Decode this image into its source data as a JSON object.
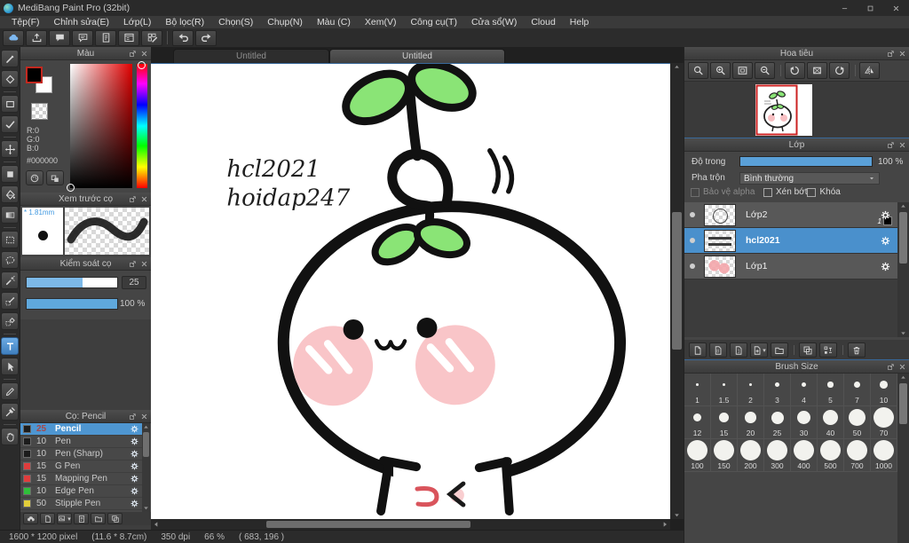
{
  "window": {
    "title": "MediBang Paint Pro (32bit)"
  },
  "menu": {
    "items": [
      "Tệp(F)",
      "Chỉnh sửa(E)",
      "Lớp(L)",
      "Bộ lọc(R)",
      "Chọn(S)",
      "Chụp(N)",
      "Màu (C)",
      "Xem(V)",
      "Công cụ(T)",
      "Cửa sổ(W)",
      "Cloud",
      "Help"
    ]
  },
  "toolbar": {
    "buttons": [
      {
        "icon": "cloud",
        "name": "cloud-save-button",
        "color": "#7db7ef"
      },
      {
        "icon": "upload",
        "name": "upload-button"
      },
      {
        "icon": "chat",
        "name": "comment-button"
      },
      {
        "icon": "chat2",
        "name": "feedback-button"
      },
      {
        "icon": "doc",
        "name": "document-button"
      },
      {
        "icon": "winlist",
        "name": "panel-layout-button"
      },
      {
        "icon": "gridpen",
        "name": "material-button"
      }
    ],
    "history": [
      {
        "icon": "undo",
        "name": "undo-button"
      },
      {
        "icon": "redo",
        "name": "redo-button"
      }
    ]
  },
  "tools": {
    "items": [
      {
        "icon": "pen",
        "name": "pen-tool"
      },
      {
        "icon": "eraser",
        "name": "eraser-tool"
      },
      {
        "icon": "rect",
        "name": "shape-tool",
        "gap": true
      },
      {
        "icon": "check",
        "name": "snap-tool"
      },
      {
        "icon": "move",
        "name": "move-tool",
        "gap": true
      },
      {
        "icon": "fillrect",
        "name": "fill-shape-tool",
        "gap": true
      },
      {
        "icon": "bucket",
        "name": "bucket-tool"
      },
      {
        "icon": "grad",
        "name": "gradient-tool"
      },
      {
        "icon": "selrect",
        "name": "select-tool",
        "gap": true
      },
      {
        "icon": "lasso",
        "name": "lasso-select-tool"
      },
      {
        "icon": "wand",
        "name": "magic-wand-tool"
      },
      {
        "icon": "selpen",
        "name": "select-pen-tool"
      },
      {
        "icon": "seleraser",
        "name": "select-eraser-tool"
      },
      {
        "icon": "text",
        "name": "text-tool",
        "active": true,
        "gap": true
      },
      {
        "icon": "cursor",
        "name": "operation-tool"
      },
      {
        "icon": "stylus",
        "name": "div-tool",
        "gap": true
      },
      {
        "icon": "dropper",
        "name": "eyedropper-tool"
      },
      {
        "icon": "hand",
        "name": "hand-tool",
        "gap": true
      }
    ]
  },
  "color_panel": {
    "title": "Màu",
    "r": "R:0",
    "g": "G:0",
    "b": "B:0",
    "hex": "#000000",
    "foreground": "#000000",
    "background": "#ffffff",
    "buttons": [
      {
        "icon": "palette",
        "name": "palette-button"
      },
      {
        "icon": "chips",
        "name": "color-chips-button"
      }
    ]
  },
  "preview_panel": {
    "title": "Xem trước cọ",
    "size": "* 1.81mm"
  },
  "control_panel": {
    "title": "Kiểm soát cọ",
    "size_value": "25",
    "size_fill": 62,
    "opacity_value": "100 %",
    "opacity_fill": 100
  },
  "brush_panel": {
    "title": "Cọ: Pencil",
    "brushes": [
      {
        "size": "25",
        "name": "Pencil",
        "swatch": "#1c1c1c",
        "selected": true
      },
      {
        "size": "10",
        "name": "Pen",
        "swatch": "#1c1c1c"
      },
      {
        "size": "10",
        "name": "Pen (Sharp)",
        "swatch": "#1c1c1c"
      },
      {
        "size": "15",
        "name": "G Pen",
        "swatch": "#e03c3c"
      },
      {
        "size": "15",
        "name": "Mapping Pen",
        "swatch": "#e03c3c"
      },
      {
        "size": "10",
        "name": "Edge Pen",
        "swatch": "#2fbf3a"
      },
      {
        "size": "50",
        "name": "Stipple Pen",
        "swatch": "#e3cf3a"
      }
    ],
    "footer": [
      {
        "icon": "cloudup",
        "name": "cloud-brush-button"
      },
      {
        "icon": "page",
        "name": "add-brush-button"
      },
      {
        "icon": "imgcaret",
        "name": "brush-from-image-button",
        "caret": true
      },
      {
        "icon": "doc",
        "name": "edit-brush-button"
      },
      {
        "icon": "folder",
        "name": "brush-folder-button"
      },
      {
        "icon": "dup",
        "name": "duplicate-brush-button"
      }
    ]
  },
  "canvas": {
    "tabs": [
      {
        "label": "Untitled",
        "active": false
      },
      {
        "label": "Untitled",
        "active": true
      }
    ],
    "signature1": "hcl2021",
    "signature2": "hoidap247"
  },
  "navigator": {
    "title": "Hoa tiêu",
    "buttons": [
      {
        "icon": "mag",
        "name": "zoom-tool-button"
      },
      {
        "icon": "magplus",
        "name": "zoom-in-button"
      },
      {
        "icon": "fit",
        "name": "fit-window-button"
      },
      {
        "icon": "magminus",
        "name": "zoom-out-button"
      },
      {
        "icon": "rotl",
        "name": "rotate-left-button",
        "gap": true
      },
      {
        "icon": "canvasreset",
        "name": "reset-view-button"
      },
      {
        "icon": "rotr",
        "name": "rotate-right-button"
      },
      {
        "icon": "flip",
        "name": "flip-view-button",
        "gap": true
      }
    ]
  },
  "layers_panel": {
    "title": "Lớp",
    "opacity_label": "Độ trong",
    "opacity_value": "100 %",
    "opacity_fill": 100,
    "blend_label": "Pha trộn",
    "blend_value": "Bình thường",
    "checkboxes": [
      {
        "label": "Bảo vệ alpha",
        "disabled": true
      },
      {
        "label": "Xén bớt",
        "disabled": false
      },
      {
        "label": "Khóa",
        "disabled": false
      }
    ],
    "layers": [
      {
        "name": "Lớp2",
        "thumb": "sketch",
        "badge": "1"
      },
      {
        "name": "hcl2021",
        "thumb": "text",
        "selected": true
      },
      {
        "name": "Lớp1",
        "thumb": "pink"
      }
    ],
    "footer": [
      {
        "icon": "page",
        "name": "add-layer-button"
      },
      {
        "icon": "page8",
        "name": "add-8bit-layer-button"
      },
      {
        "icon": "page1",
        "name": "add-1bit-layer-button"
      },
      {
        "icon": "pageplus",
        "name": "add-layer-menu-button",
        "caret": true
      },
      {
        "icon": "folder",
        "name": "layer-folder-button"
      },
      {
        "icon": "dup",
        "name": "duplicate-layer-button",
        "gap": true
      },
      {
        "icon": "merge",
        "name": "merge-layer-button"
      },
      {
        "icon": "trash",
        "name": "delete-layer-button",
        "gap": true
      }
    ]
  },
  "brush_size_panel": {
    "title": "Brush Size",
    "sizes": [
      "1",
      "1.5",
      "2",
      "3",
      "4",
      "5",
      "7",
      "10",
      "12",
      "15",
      "20",
      "25",
      "30",
      "40",
      "50",
      "70",
      "100",
      "150",
      "200",
      "300",
      "400",
      "500",
      "700",
      "1000"
    ]
  },
  "statusbar": {
    "dimensions": "1600 * 1200 pixel",
    "physical": "(11.6 * 8.7cm)",
    "dpi": "350 dpi",
    "zoom": "66 %",
    "cursor": "( 683, 196 )"
  }
}
